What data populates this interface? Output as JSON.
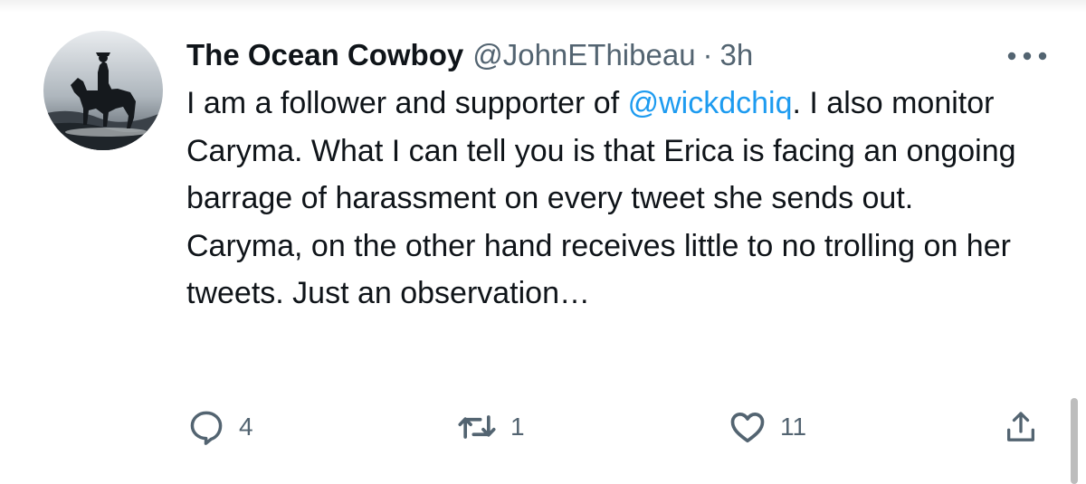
{
  "tweet": {
    "display_name": "The Ocean Cowboy",
    "handle": "@JohnEThibeau",
    "separator": "·",
    "time": "3h",
    "text_before_mention": "I am a follower and supporter of ",
    "mention": "@wickdchiq",
    "text_after_mention": ". I also monitor Caryma. What I can tell you is that Erica is facing an ongoing barrage of harassment on every tweet she sends out. Caryma, on the other hand receives little to no trolling on her tweets. Just an observation…"
  },
  "actions": {
    "reply_count": "4",
    "retweet_count": "1",
    "like_count": "11"
  },
  "icons": {
    "reply": "reply-bubble-icon",
    "retweet": "retweet-arrows-icon",
    "like": "heart-icon",
    "share": "share-upload-icon",
    "more": "more-dots-icon"
  },
  "colors": {
    "text": "#0f1419",
    "secondary": "#536471",
    "link": "#1d9bf0"
  }
}
